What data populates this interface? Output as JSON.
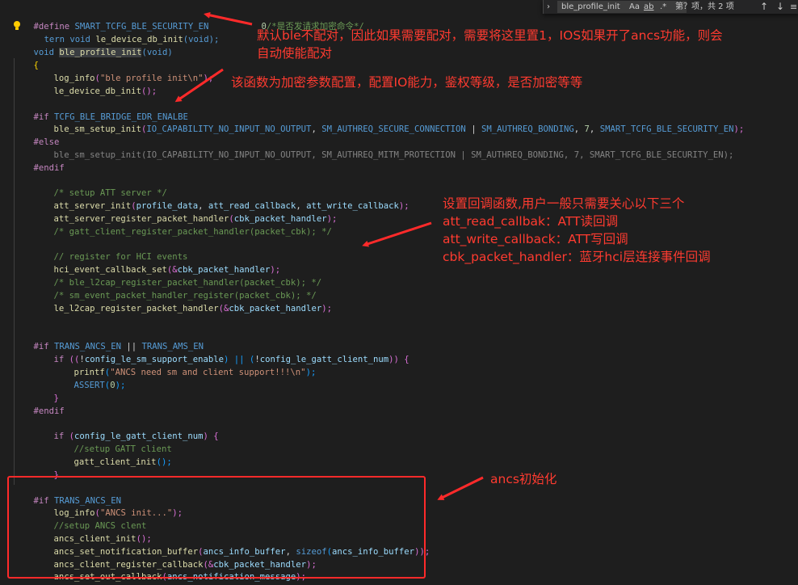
{
  "find_widget": {
    "query": "ble_profile_init",
    "match_case_label": "Aa",
    "whole_word_label": "ab",
    "regex_label": ".*",
    "result_text": "第？项，共 2 项",
    "prev_icon": "arrow-up-icon",
    "next_icon": "arrow-down-icon",
    "close_icon": "close-icon",
    "toggle_icon": "chevron-right-icon"
  },
  "code": {
    "l1": {
      "a": "#define",
      "b": " SMART_TCFG_BLE_SECURITY_EN",
      "c": "0",
      "d": "/*是否发请求加密命令*/"
    },
    "l2": {
      "a": "tern",
      "b": " void ",
      "c": "le_device_db_init",
      "d": "(void);"
    },
    "l3": {
      "a": "void ",
      "b": "ble_profile_init",
      "c": "(void)"
    },
    "l4": {
      "a": "{"
    },
    "l5": {
      "a": "log_info",
      "b": "(",
      "c": "\"ble profile init\\n\"",
      "d": ");"
    },
    "l6": {
      "a": "le_device_db_init",
      "b": "();"
    },
    "l7": {
      "a": "#if",
      "b": " TCFG_BLE_BRIDGE_EDR_ENALBE"
    },
    "l8": {
      "a": "ble_sm_setup_init",
      "b": "(",
      "c": "IO_CAPABILITY_NO_INPUT_NO_OUTPUT",
      "d": ", ",
      "e": "SM_AUTHREQ_SECURE_CONNECTION",
      "f": " | ",
      "g": "SM_AUTHREQ_BONDING",
      "h": ", ",
      "i": "7",
      "j": ", ",
      "k": "SMART_TCFG_BLE_SECURITY_EN",
      "l": ");"
    },
    "l9": {
      "a": "#else"
    },
    "l10": {
      "a": "ble_sm_setup_init(IO_CAPABILITY_NO_INPUT_NO_OUTPUT, SM_AUTHREQ_MITM_PROTECTION | SM_AUTHREQ_BONDING, 7, SMART_TCFG_BLE_SECURITY_EN);"
    },
    "l11": {
      "a": "#endif"
    },
    "l12": {
      "a": "/* setup ATT server */"
    },
    "l13": {
      "a": "att_server_init",
      "b": "(",
      "c": "profile_data",
      "d": ", ",
      "e": "att_read_callback",
      "f": ", ",
      "g": "att_write_callback",
      "h": ");"
    },
    "l14": {
      "a": "att_server_register_packet_handler",
      "b": "(",
      "c": "cbk_packet_handler",
      "d": ");"
    },
    "l15": {
      "a": "/* gatt_client_register_packet_handler(packet_cbk); */"
    },
    "l16": {
      "a": "// register for HCI events"
    },
    "l17": {
      "a": "hci_event_callback_set",
      "b": "(&",
      "c": "cbk_packet_handler",
      "d": ");"
    },
    "l18": {
      "a": "/* ble_l2cap_register_packet_handler(packet_cbk); */"
    },
    "l19": {
      "a": "/* sm_event_packet_handler_register(packet_cbk); */"
    },
    "l20": {
      "a": "le_l2cap_register_packet_handler",
      "b": "(&",
      "c": "cbk_packet_handler",
      "d": ");"
    },
    "l21": {
      "a": "#if",
      "b": " TRANS_ANCS_EN",
      "c": " || ",
      "d": "TRANS_AMS_EN"
    },
    "l22": {
      "a": "if",
      "b": " ((",
      "c": "!",
      "d": "config_le_sm_support_enable",
      "e": ") || (",
      "f": "!",
      "g": "config_le_gatt_client_num",
      "h": ")) {"
    },
    "l23": {
      "a": "printf",
      "b": "(",
      "c": "\"ANCS need sm and client support!!!\\n\"",
      "d": ");"
    },
    "l24": {
      "a": "ASSERT",
      "b": "(",
      "c": "0",
      "d": ");"
    },
    "l25": {
      "a": "}"
    },
    "l26": {
      "a": "#endif"
    },
    "l27": {
      "a": "if",
      "b": " (",
      "c": "config_le_gatt_client_num",
      "d": ") {"
    },
    "l28": {
      "a": "//setup GATT client"
    },
    "l29": {
      "a": "gatt_client_init",
      "b": "();"
    },
    "l30": {
      "a": "}"
    },
    "l31": {
      "a": "#if",
      "b": " TRANS_ANCS_EN"
    },
    "l32": {
      "a": "log_info",
      "b": "(",
      "c": "\"ANCS init...\"",
      "d": ");"
    },
    "l33": {
      "a": "//setup ANCS clent"
    },
    "l34": {
      "a": "ancs_client_init",
      "b": "();"
    },
    "l35": {
      "a": "ancs_set_notification_buffer",
      "b": "(",
      "c": "ancs_info_buffer",
      "d": ", ",
      "e": "sizeof",
      "f": "(",
      "g": "ancs_info_buffer",
      "h": "));"
    },
    "l36": {
      "a": "ancs_client_register_callback",
      "b": "(&",
      "c": "cbk_packet_handler",
      "d": ");"
    },
    "l37": {
      "a": "ancs_set_out_callback",
      "b": "(",
      "c": "ancs_notification_message",
      "d": ");"
    }
  },
  "annotations": {
    "a1_line1": "默认ble不配对，因此如果需要配对，需要将这里置1，IOS如果开了ancs功能，则会",
    "a1_line2": "自动使能配对",
    "a2": "该函数为加密参数配置，配置IO能力，鉴权等级，是否加密等等",
    "a3_line1": "设置回调函数,用户一般只需要关心以下三个",
    "a3_line2": "att_read_callbak：ATT读回调",
    "a3_line3": "att_write_callback：ATT写回调",
    "a3_line4": "cbk_packet_handler：蓝牙hci层连接事件回调",
    "a4": "ancs初始化"
  },
  "colors": {
    "background": "#1e1e1e",
    "annotation_red": "#ff3b30",
    "keyword": "#569cd6",
    "preprocessor": "#c586c0",
    "function": "#dcdcaa",
    "string": "#ce9178",
    "comment": "#6a9955"
  }
}
